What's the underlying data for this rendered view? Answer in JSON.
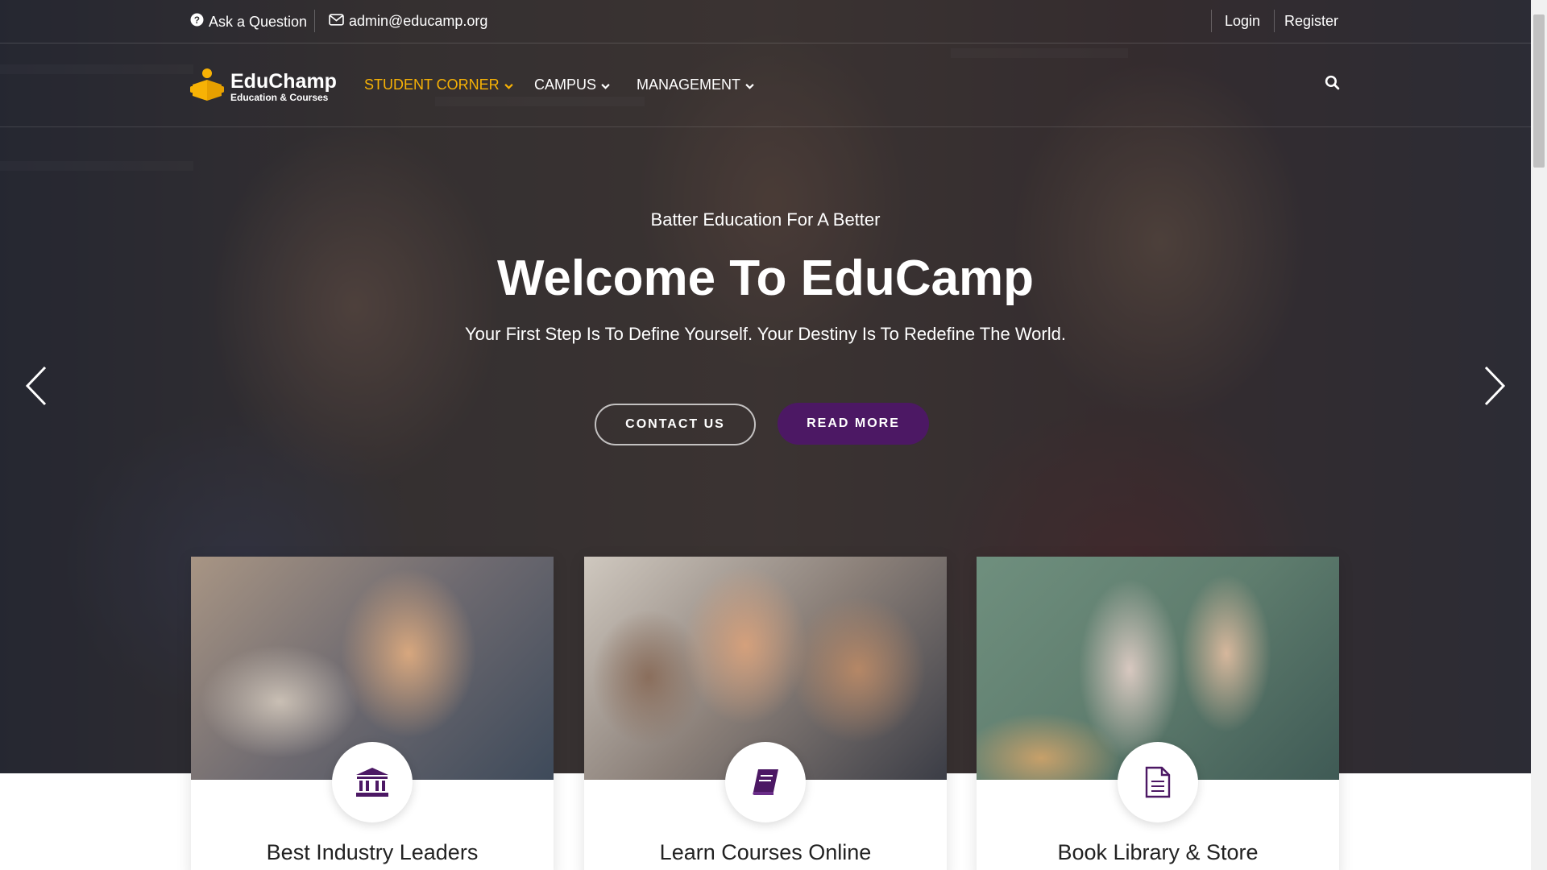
{
  "topbar": {
    "ask_label": "Ask a Question",
    "email": "admin@educamp.org",
    "login_label": "Login",
    "register_label": "Register"
  },
  "brand": {
    "name": "EduChamp",
    "tagline": "Education & Courses",
    "accent_color": "#f7b205"
  },
  "nav": {
    "items": [
      {
        "label": "STUDENT CORNER",
        "active": true
      },
      {
        "label": "CAMPUS",
        "active": false
      },
      {
        "label": "MANAGEMENT",
        "active": false
      }
    ],
    "search_icon": "search-icon"
  },
  "hero": {
    "kicker": "Batter Education For A Better",
    "headline": "Welcome To EduCamp",
    "tagline": "Your First Step Is To Define Yourself. Your Destiny Is To Redefine The World.",
    "contact_label": "CONTACT US",
    "read_more_label": "READ MORE",
    "primary_color": "#4c1864"
  },
  "cards": [
    {
      "title": "Best Industry Leaders",
      "icon": "bank-icon"
    },
    {
      "title": "Learn Courses Online",
      "icon": "book-icon"
    },
    {
      "title": "Book Library & Store",
      "icon": "document-icon"
    }
  ]
}
